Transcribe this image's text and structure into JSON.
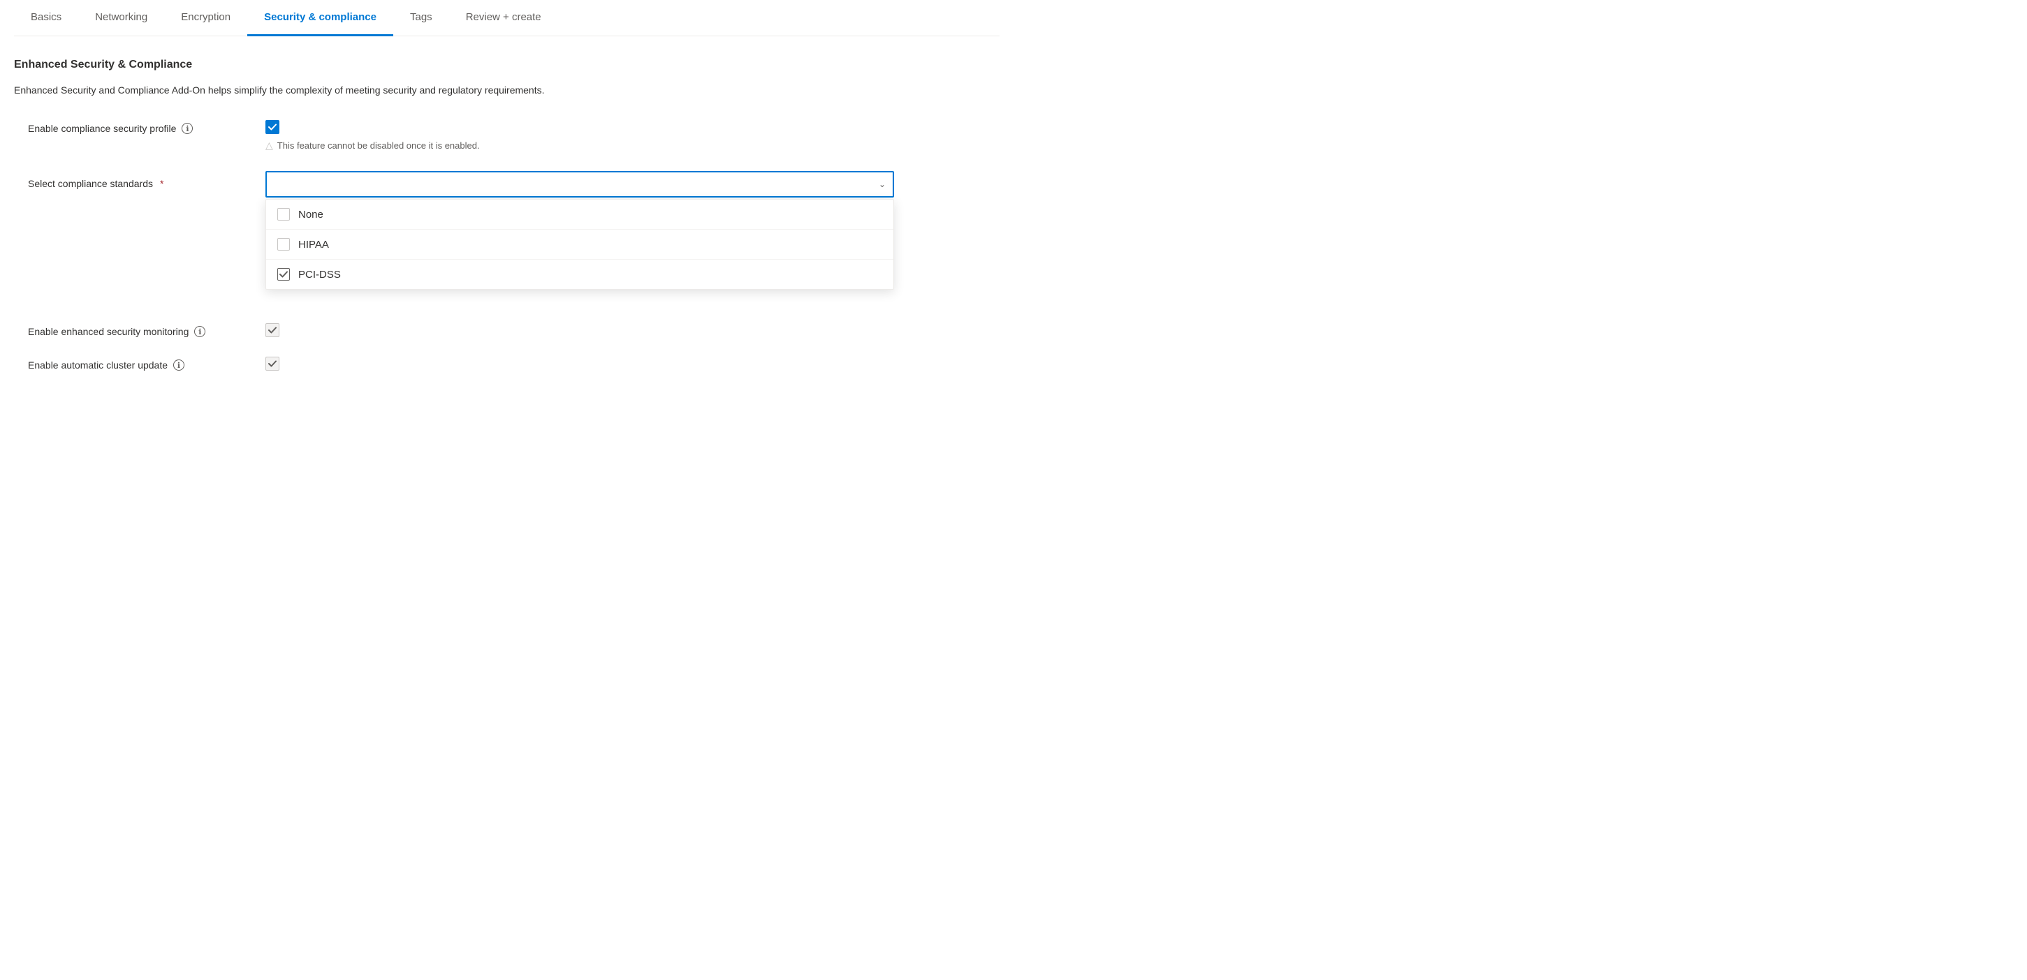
{
  "tabs": [
    {
      "id": "basics",
      "label": "Basics",
      "active": false
    },
    {
      "id": "networking",
      "label": "Networking",
      "active": false
    },
    {
      "id": "encryption",
      "label": "Encryption",
      "active": false
    },
    {
      "id": "security",
      "label": "Security & compliance",
      "active": true
    },
    {
      "id": "tags",
      "label": "Tags",
      "active": false
    },
    {
      "id": "review",
      "label": "Review + create",
      "active": false
    }
  ],
  "section": {
    "heading": "Enhanced Security & Compliance",
    "description": "Enhanced Security and Compliance Add-On helps simplify the complexity of meeting security and regulatory requirements."
  },
  "fields": {
    "compliance_profile": {
      "label": "Enable compliance security profile",
      "checked": true
    },
    "warning_text": "This feature cannot be disabled once it is enabled.",
    "compliance_standards": {
      "label": "Select compliance standards",
      "required": true,
      "placeholder": "",
      "options": [
        {
          "id": "none",
          "label": "None",
          "checked": false
        },
        {
          "id": "hipaa",
          "label": "HIPAA",
          "checked": false
        },
        {
          "id": "pci-dss",
          "label": "PCI-DSS",
          "checked": true
        }
      ]
    },
    "security_monitoring": {
      "label": "Enable enhanced security monitoring",
      "checked": true,
      "disabled": true
    },
    "cluster_update": {
      "label": "Enable automatic cluster update",
      "checked": true,
      "disabled": true
    }
  },
  "icons": {
    "info": "ℹ",
    "chevron_down": "∨",
    "check": "✓",
    "warning_triangle": "△"
  }
}
